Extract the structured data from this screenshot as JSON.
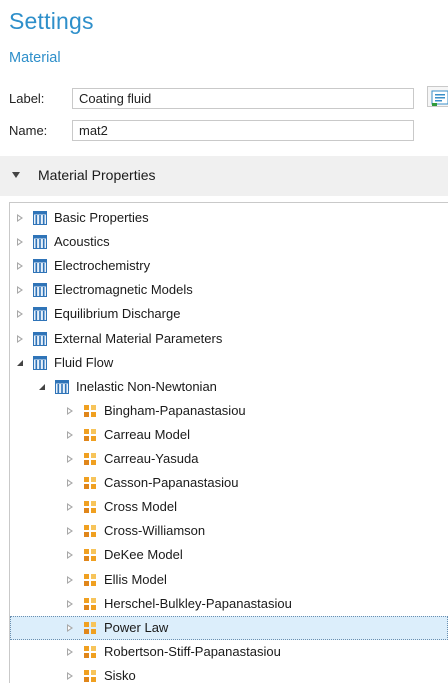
{
  "header": {
    "title": "Settings",
    "subtitle": "Material"
  },
  "fields": {
    "label": {
      "caption": "Label:",
      "value": "Coating fluid"
    },
    "name": {
      "caption": "Name:",
      "value": "mat2"
    }
  },
  "section": {
    "title": "Material Properties"
  },
  "tree": {
    "categories": [
      {
        "label": "Basic Properties",
        "state": "collapsed"
      },
      {
        "label": "Acoustics",
        "state": "collapsed"
      },
      {
        "label": "Electrochemistry",
        "state": "collapsed"
      },
      {
        "label": "Electromagnetic Models",
        "state": "collapsed"
      },
      {
        "label": "Equilibrium Discharge",
        "state": "collapsed"
      },
      {
        "label": "External Material Parameters",
        "state": "collapsed"
      },
      {
        "label": "Fluid Flow",
        "state": "expanded"
      }
    ],
    "subcategory": {
      "label": "Inelastic Non-Newtonian",
      "state": "expanded"
    },
    "models": [
      "Bingham-Papanastasiou",
      "Carreau Model",
      "Carreau-Yasuda",
      "Casson-Papanastasiou",
      "Cross Model",
      "Cross-Williamson",
      "DeKee Model",
      "Ellis Model",
      "Herschel-Bulkley-Papanastasiou",
      "Power Law",
      "Robertson-Stiff-Papanastasiou",
      "Sisko"
    ],
    "selected": "Power Law"
  },
  "colors": {
    "accent": "#2e8fca",
    "selection": "#dceefb",
    "folder_icon": "#2f74b8",
    "model_icon": "#f0a020"
  },
  "icons": {
    "category": "property-group-icon",
    "model": "model-cube-icon",
    "edit": "edit-note-icon"
  }
}
